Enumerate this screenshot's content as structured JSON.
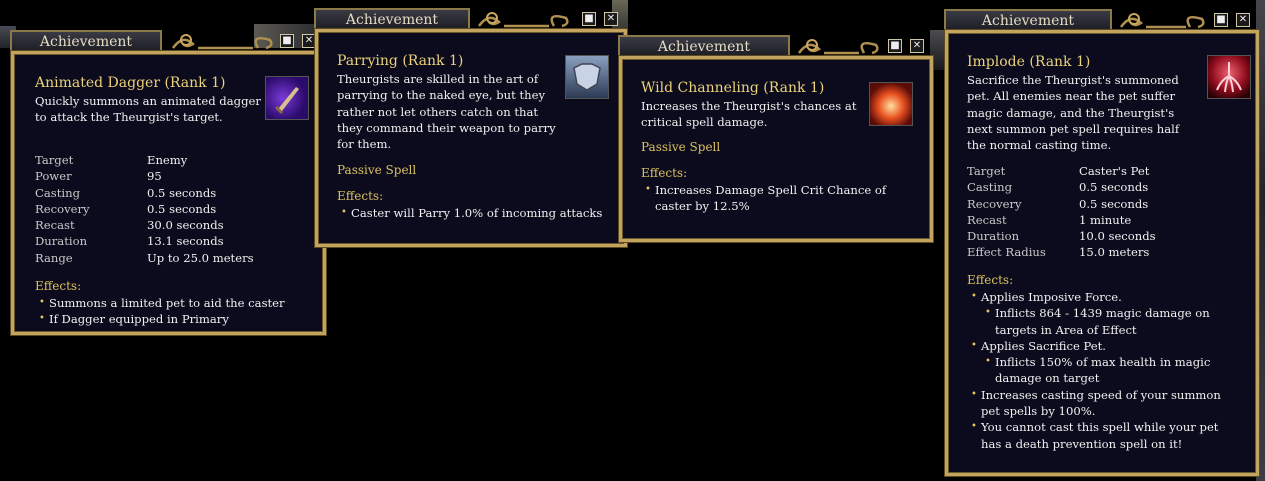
{
  "colors": {
    "panel_bg": "#0b0b1d",
    "gold_frame": "#c2a45e",
    "name_gold": "#ecd27a",
    "heading_gold": "#dcc262",
    "text": "#f1f1f1"
  },
  "windows": [
    {
      "tab_label": "Achievement",
      "controls": {
        "minimize": "■",
        "close": "✕"
      },
      "name": "Animated Dagger (Rank 1)",
      "icon": "dagger-icon",
      "description": "Quickly summons an animated dagger to attack the Theurgist's target.",
      "stats": [
        {
          "label": "Target",
          "value": "Enemy"
        },
        {
          "label": "Power",
          "value": "95"
        },
        {
          "label": "Casting",
          "value": "0.5 seconds"
        },
        {
          "label": "Recovery",
          "value": "0.5 seconds"
        },
        {
          "label": "Recast",
          "value": "30.0 seconds"
        },
        {
          "label": "Duration",
          "value": "13.1 seconds"
        },
        {
          "label": "Range",
          "value": "Up to 25.0 meters"
        }
      ],
      "effects_heading": "Effects:",
      "effects": [
        {
          "text": "Summons a limited pet to aid the caster",
          "level": 0
        },
        {
          "text": "If Dagger equipped in Primary",
          "level": 0
        }
      ]
    },
    {
      "tab_label": "Achievement",
      "controls": {
        "minimize": "■",
        "close": "✕"
      },
      "name": "Parrying (Rank 1)",
      "icon": "armor-icon",
      "description": "Theurgists are skilled in the art of parrying to the naked eye, but they rather not let others catch on that they command their weapon to parry for them.",
      "spell_type": "Passive Spell",
      "effects_heading": "Effects:",
      "effects": [
        {
          "text": "Caster will Parry 1.0% of incoming attacks",
          "level": 0
        }
      ]
    },
    {
      "tab_label": "Achievement",
      "controls": {
        "minimize": "■",
        "close": "✕"
      },
      "name": "Wild Channeling (Rank 1)",
      "icon": "fire-burst-icon",
      "description": "Increases the Theurgist's chances at critical spell damage.",
      "spell_type": "Passive Spell",
      "effects_heading": "Effects:",
      "effects": [
        {
          "text": "Increases Damage Spell Crit Chance of caster by 12.5%",
          "level": 0
        }
      ]
    },
    {
      "tab_label": "Achievement",
      "controls": {
        "minimize": "■",
        "close": "✕"
      },
      "name": "Implode (Rank 1)",
      "icon": "implode-icon",
      "description": "Sacrifice the Theurgist's summoned pet. All enemies near the pet suffer magic damage, and the Theurgist's next summon pet spell requires half the normal casting time.",
      "stats": [
        {
          "label": "Target",
          "value": "Caster's Pet"
        },
        {
          "label": "Casting",
          "value": "0.5 seconds"
        },
        {
          "label": "Recovery",
          "value": "0.5 seconds"
        },
        {
          "label": "Recast",
          "value": "1 minute"
        },
        {
          "label": "Duration",
          "value": "10.0 seconds"
        },
        {
          "label": "Effect Radius",
          "value": "15.0 meters"
        }
      ],
      "effects_heading": "Effects:",
      "effects": [
        {
          "text": "Applies Imposive Force.",
          "level": 0
        },
        {
          "text": "Inflicts 864 - 1439 magic damage on targets in Area of Effect",
          "level": 1
        },
        {
          "text": "Applies Sacrifice Pet.",
          "level": 0
        },
        {
          "text": "Inflicts 150% of max health in magic damage on target",
          "level": 1
        },
        {
          "text": "Increases casting speed of your summon pet spells by 100%.",
          "level": 0
        },
        {
          "text": "You cannot cast this spell while your pet has a death prevention spell on it!",
          "level": 0
        }
      ]
    }
  ]
}
